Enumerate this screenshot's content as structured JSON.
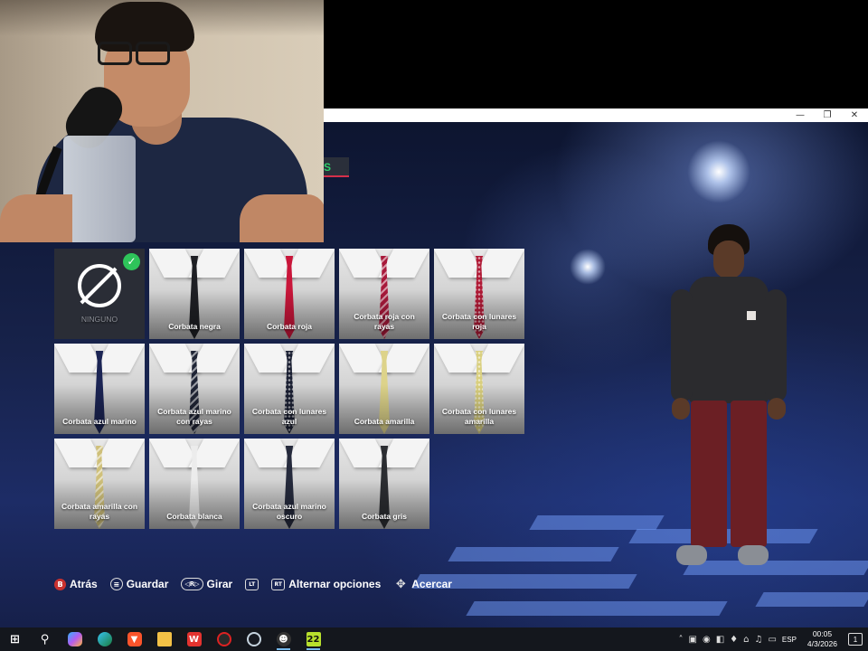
{
  "window": {
    "minimize": "—",
    "restore": "❐",
    "close": "✕"
  },
  "tab_fragment": "S",
  "ties": {
    "selected": "NINGUNO",
    "items": [
      {
        "label": "NINGUNO",
        "color": ""
      },
      {
        "label": "Corbata negra",
        "color": "#1e1f24"
      },
      {
        "label": "Corbata roja",
        "color": "#c9163a"
      },
      {
        "label": "Corbata roja con rayas",
        "color": "#a8193a"
      },
      {
        "label": "Corbata con lunares roja",
        "color": "#b01a36"
      },
      {
        "label": "Corbata azul marino",
        "color": "#1b2454"
      },
      {
        "label": "Corbata azul marino con rayas",
        "color": "#202536"
      },
      {
        "label": "Corbata con lunares azul",
        "color": "#1b2033"
      },
      {
        "label": "Corbata amarilla",
        "color": "#ddd38a"
      },
      {
        "label": "Corbata con lunares amarilla",
        "color": "#d9cf7e"
      },
      {
        "label": "Corbata amarilla con rayas",
        "color": "#cfc07a"
      },
      {
        "label": "Corbata blanca",
        "color": "#ececec"
      },
      {
        "label": "Corbata azul marino oscuro",
        "color": "#252a3c"
      },
      {
        "label": "Corbata gris",
        "color": "#2b2d31"
      }
    ]
  },
  "controls": [
    {
      "button": "B",
      "label": "Atrás"
    },
    {
      "button": "≡",
      "label": "Guardar"
    },
    {
      "button": "◁R▷",
      "label": "Girar"
    },
    {
      "button": "LT",
      "label": ""
    },
    {
      "button": "RT",
      "label": "Alternar opciones"
    },
    {
      "button": "✥",
      "label": "Acercar"
    }
  ],
  "taskbar": {
    "apps": [
      "start-icon",
      "search-icon",
      "copilot-icon",
      "edge-icon",
      "brave-icon",
      "file-explorer-icon",
      "wps-icon",
      "rec-icon",
      "steam-icon",
      "game-icon",
      "nba2k22-icon"
    ],
    "app_22_label": "22",
    "language": "ESP",
    "time": "00:05",
    "date": "4/3/2026",
    "notification_count": "1"
  }
}
